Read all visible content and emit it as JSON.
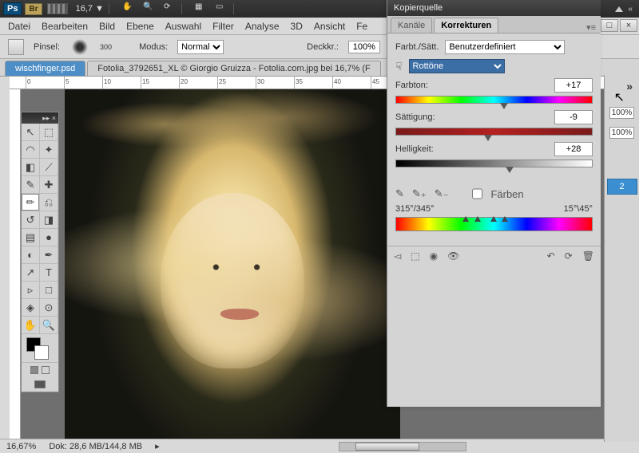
{
  "titlebar": {
    "zoom": "16,7",
    "arrow": "▼"
  },
  "menu": {
    "items": [
      "Datei",
      "Bearbeiten",
      "Bild",
      "Ebene",
      "Auswahl",
      "Filter",
      "Analyse",
      "3D",
      "Ansicht",
      "Fe"
    ]
  },
  "optbar": {
    "pinsel_label": "Pinsel:",
    "pinsel_val": "300",
    "modus_label": "Modus:",
    "modus_val": "Normal",
    "deckkr_label": "Deckkr.:",
    "deckkr_val": "100%"
  },
  "tabs": {
    "active": "wischfinger.psd",
    "inactive": "Fotolia_3792651_XL © Giorgio Gruizza - Fotolia.com.jpg bei 16,7% (F"
  },
  "ruler_labels": [
    "0",
    "5",
    "10",
    "15",
    "20",
    "25",
    "30",
    "35",
    "40",
    "45"
  ],
  "panel": {
    "title": "Kopierquelle",
    "tab_kanale": "Kanäle",
    "tab_korrekturen": "Korrekturen",
    "preset_label": "Farbt./Sätt.",
    "preset_val": "Benutzerdefiniert",
    "channel_val": "Rottöne",
    "farbton_label": "Farbton:",
    "farbton_val": "+17",
    "satt_label": "Sättigung:",
    "satt_val": "-9",
    "hell_label": "Helligkeit:",
    "hell_val": "+28",
    "faerben": "Färben",
    "ang_left": "315°/345°",
    "ang_right": "15°\\45°"
  },
  "right": {
    "pct": "100%",
    "blue": "2"
  },
  "status": {
    "zoom": "16,67%",
    "dok": "Dok: 28,6 MB/144,8 MB"
  }
}
